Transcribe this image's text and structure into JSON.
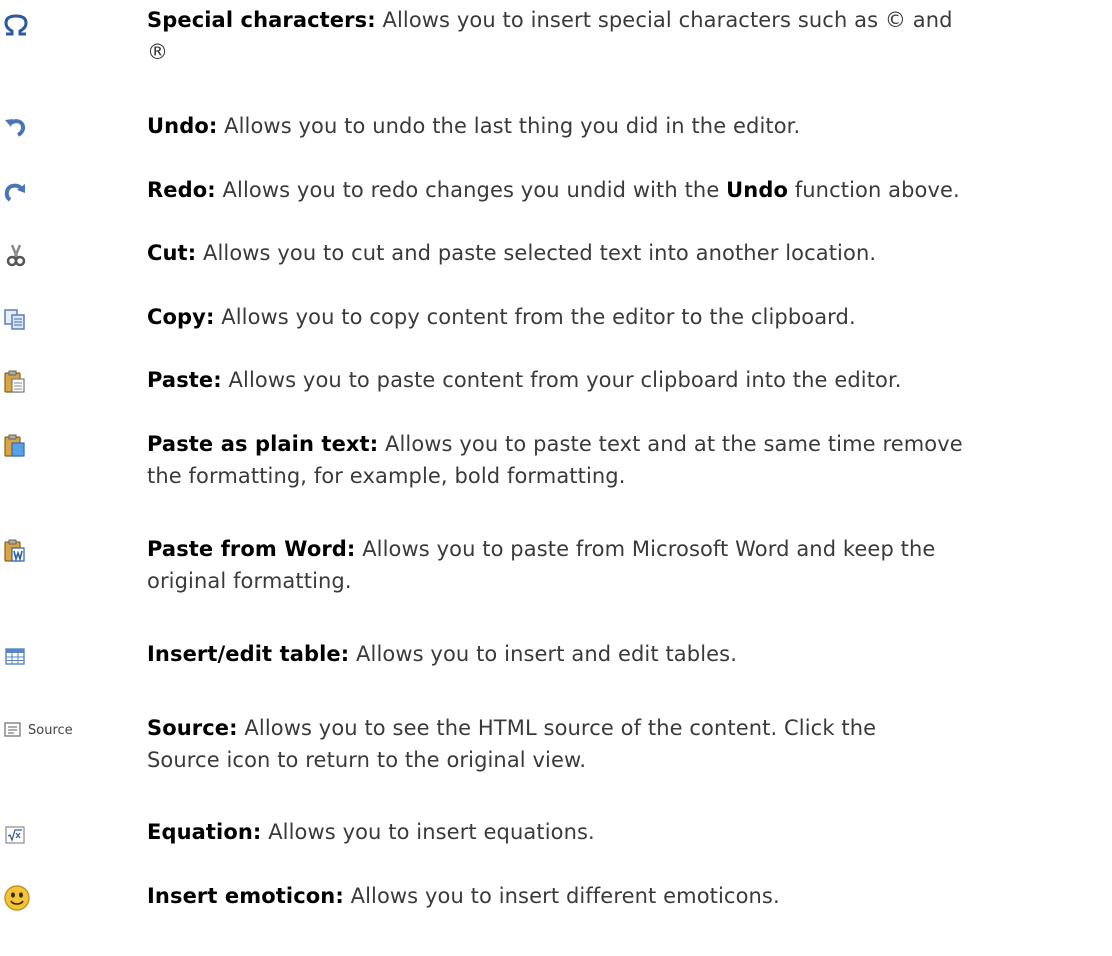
{
  "items": [
    {
      "icon": "omega-icon",
      "term": "Special characters:",
      "desc": [
        " Allows you to insert special characters such as © and",
        "®"
      ]
    },
    {
      "icon": "undo-icon",
      "term": "Undo:",
      "desc": [
        " Allows you to undo the last thing you did in the editor."
      ]
    },
    {
      "icon": "redo-icon",
      "term": "Redo:",
      "desc_pre": " Allows you to redo changes you undid with the ",
      "desc_bold": "Undo",
      "desc_post": " function above."
    },
    {
      "icon": "scissors-icon",
      "term": "Cut:",
      "desc": [
        " Allows you to cut and paste selected text into another location."
      ]
    },
    {
      "icon": "copy-icon",
      "term": "Copy:",
      "desc": [
        " Allows you to copy content from the editor to the clipboard."
      ]
    },
    {
      "icon": "paste-icon",
      "term": "Paste:",
      "desc": [
        " Allows you to paste content from your clipboard into the editor."
      ]
    },
    {
      "icon": "paste-plain-text-icon",
      "term": "Paste as plain text:",
      "desc": [
        " Allows you to paste text and at the same time remove",
        "the formatting, for example, bold formatting."
      ]
    },
    {
      "icon": "paste-from-word-icon",
      "term": "Paste from Word:",
      "desc": [
        " Allows you to paste from Microsoft Word and keep the",
        "original formatting."
      ]
    },
    {
      "icon": "table-icon",
      "term": "Insert/edit table:",
      "desc": [
        " Allows you to insert and edit tables."
      ]
    },
    {
      "icon": "source-icon",
      "icon_label": "Source",
      "term": "Source:",
      "desc": [
        " Allows you to see the HTML source of the content. Click the",
        "Source icon to return to the original view."
      ]
    },
    {
      "icon": "equation-icon",
      "term": "Equation:",
      "desc": [
        " Allows you to insert equations."
      ]
    },
    {
      "icon": "emoticon-icon",
      "term": "Insert emoticon:",
      "desc": [
        " Allows you to insert different emoticons."
      ]
    }
  ],
  "colors": {
    "icon_blue": "#4a76b8",
    "emoticon_yellow": "#f3c43a"
  }
}
